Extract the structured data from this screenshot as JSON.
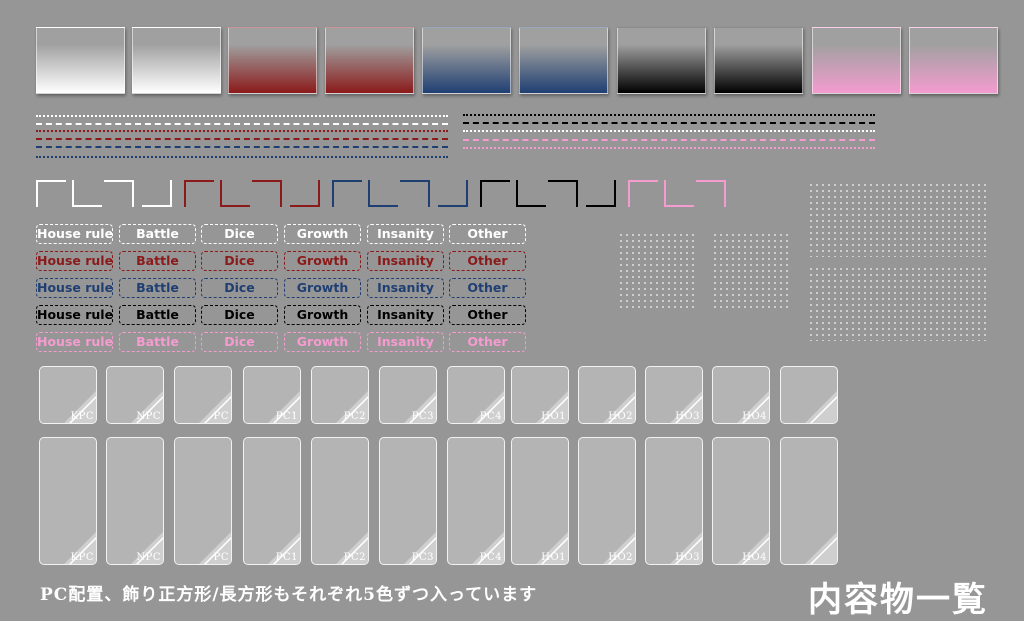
{
  "palette": {
    "white": "#ffffff",
    "red": "#8b1a1a",
    "blue": "#1f3f73",
    "black": "#000000",
    "pink": "#f49ccf",
    "background": "#969696"
  },
  "swatches": [
    {
      "name": "white-gradient-square",
      "color": "#ffffff"
    },
    {
      "name": "white-gradient-square",
      "color": "#ffffff"
    },
    {
      "name": "red-gradient-square",
      "color": "#8b1a1a"
    },
    {
      "name": "red-gradient-square",
      "color": "#8b1a1a"
    },
    {
      "name": "blue-gradient-square",
      "color": "#1f3f73"
    },
    {
      "name": "blue-gradient-square",
      "color": "#1f3f73"
    },
    {
      "name": "black-gradient-square",
      "color": "#000000"
    },
    {
      "name": "black-gradient-square",
      "color": "#000000"
    },
    {
      "name": "pink-gradient-square",
      "color": "#f49ccf"
    },
    {
      "name": "pink-gradient-square",
      "color": "#f49ccf"
    }
  ],
  "tags": {
    "labels": [
      "House rule",
      "Battle",
      "Dice",
      "Growth",
      "Insanity",
      "Other"
    ],
    "rows": [
      {
        "color": "#ffffff"
      },
      {
        "color": "#8b1a1a"
      },
      {
        "color": "#1f3f73"
      },
      {
        "color": "#000000"
      },
      {
        "color": "#f49ccf"
      }
    ]
  },
  "cards": {
    "labels": [
      "KPC",
      "NPC",
      "PC",
      "PC1",
      "PC2",
      "PC3",
      "PC4",
      "HO1",
      "HO2",
      "HO3",
      "HO4",
      ""
    ]
  },
  "caption": "PC配置、飾り正方形/長方形もそれぞれ5色ずつ入っています",
  "title": "内容物一覧"
}
